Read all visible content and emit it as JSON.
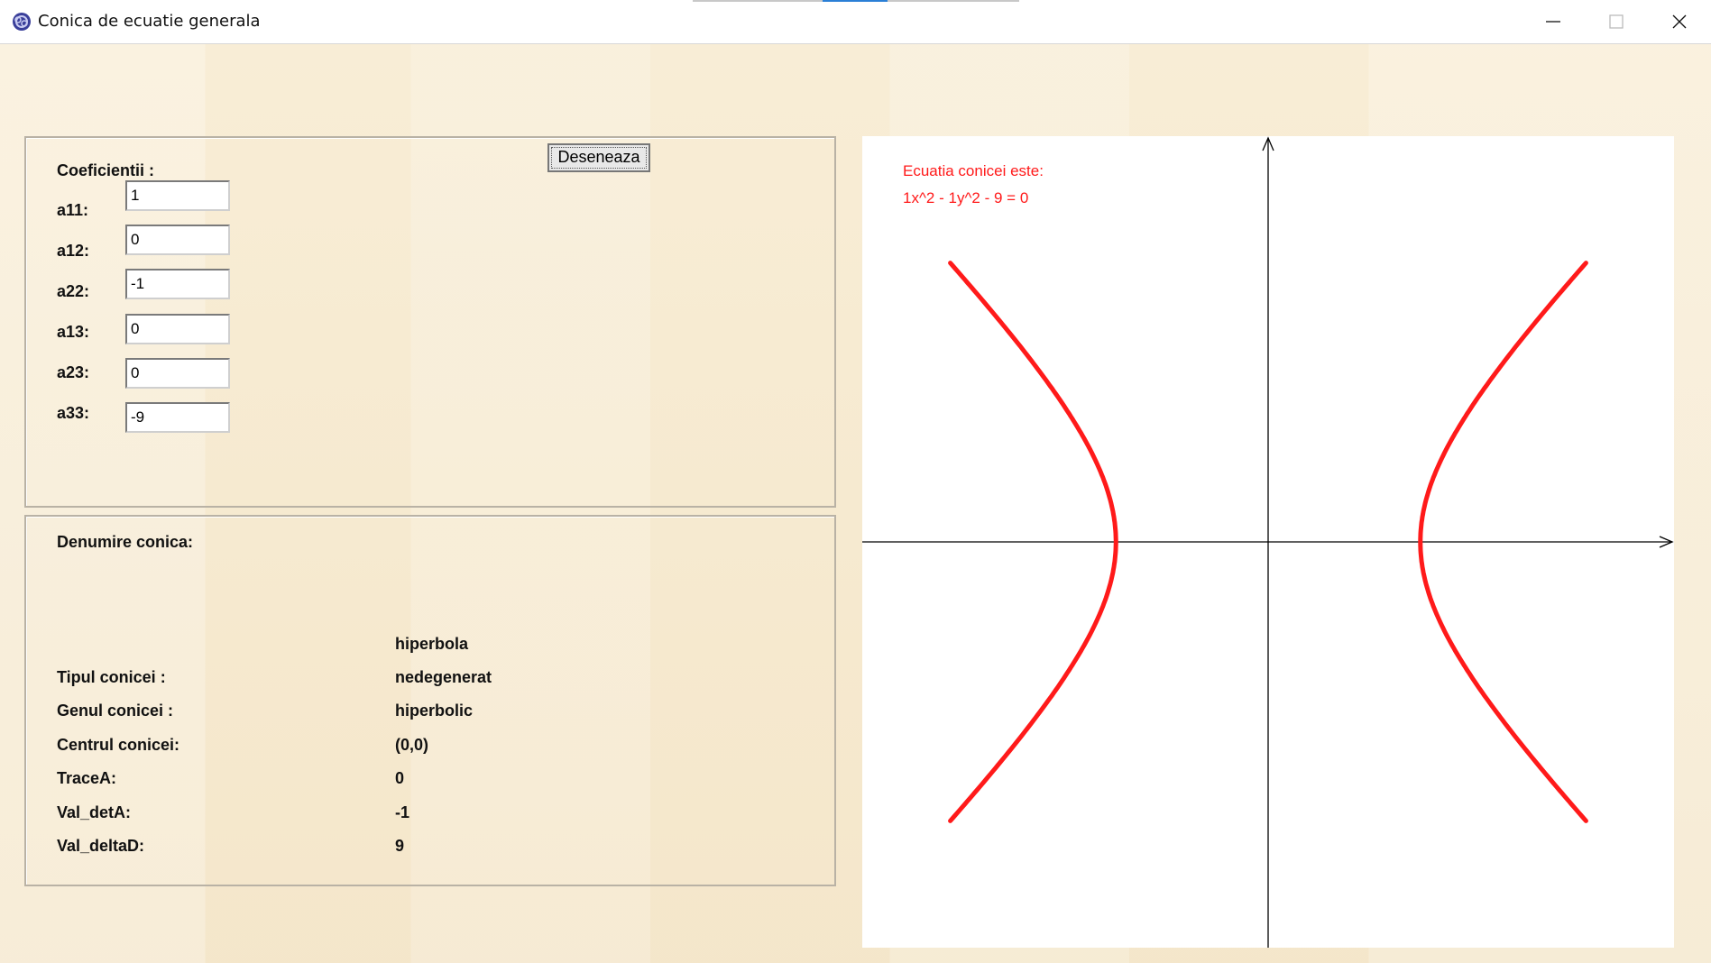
{
  "window": {
    "title": "Conica de ecuatie generala",
    "app_icon": "app-icon",
    "controls": [
      "minimize-icon",
      "maximize-icon",
      "close-icon"
    ]
  },
  "toolbar": {
    "draw_label": "Deseneaza"
  },
  "coefficients": {
    "heading": "Coeficientii :",
    "fields": [
      {
        "label": "a11:",
        "value": "1"
      },
      {
        "label": "a12:",
        "value": "0"
      },
      {
        "label": "a22:",
        "value": "-1"
      },
      {
        "label": "a13:",
        "value": "0"
      },
      {
        "label": "a23:",
        "value": "0"
      },
      {
        "label": "a33:",
        "value": "-9"
      }
    ]
  },
  "results": {
    "heading": "Denumire conica:",
    "name": "hiperbola",
    "rows": [
      {
        "label": "Tipul conicei :",
        "value": "nedegenerat"
      },
      {
        "label": "Genul conicei :",
        "value": "hiperbolic"
      },
      {
        "label": "Centrul conicei:",
        "value": "(0,0)"
      },
      {
        "label": "TraceA:",
        "value": "0"
      },
      {
        "label": "Val_detA:",
        "value": "-1"
      },
      {
        "label": "Val_deltaD:",
        "value": "9"
      }
    ]
  },
  "plot": {
    "equation_caption": "Ecuatia conicei este:",
    "equation": "1x^2 - 1y^2 - 9 = 0",
    "curve_color": "#ff1a1a",
    "axis_color": "#000000"
  },
  "chart_data": {
    "type": "line",
    "curve": "hyperbola",
    "equation": "1x^2 - 1y^2 - 9 = 0",
    "a11": 1,
    "a12": 0,
    "a22": -1,
    "a13": 0,
    "a23": 0,
    "a33": -9,
    "center": [
      0,
      0
    ],
    "x_range": [
      -8,
      8
    ],
    "y_range": [
      -8,
      8
    ],
    "branch_y_extent": 5.5
  }
}
